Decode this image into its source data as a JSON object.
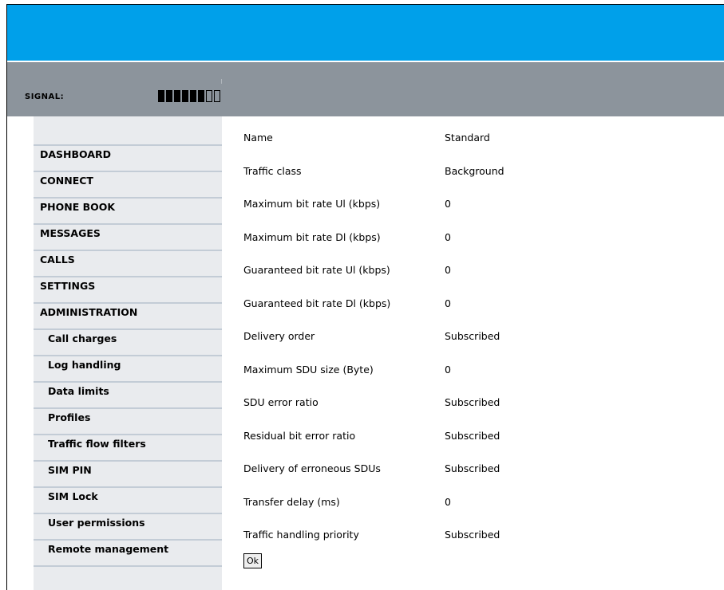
{
  "header": {
    "signal_label": "SIGNAL:",
    "signal_level": 6,
    "signal_max": 8,
    "brand_color": "#00a0ea",
    "status_bar_color": "#8c949c"
  },
  "sidebar": {
    "items": [
      {
        "label": "DASHBOARD"
      },
      {
        "label": "CONNECT"
      },
      {
        "label": "PHONE BOOK"
      },
      {
        "label": "MESSAGES"
      },
      {
        "label": "CALLS"
      },
      {
        "label": "SETTINGS"
      },
      {
        "label": "ADMINISTRATION"
      },
      {
        "label": "Call charges"
      },
      {
        "label": "Log handling"
      },
      {
        "label": "Data limits"
      },
      {
        "label": "Profiles"
      },
      {
        "label": "Traffic flow filters"
      },
      {
        "label": "SIM PIN"
      },
      {
        "label": "SIM Lock"
      },
      {
        "label": "User permissions"
      },
      {
        "label": "Remote management"
      }
    ]
  },
  "profile": {
    "rows": [
      {
        "label": "Name",
        "value": "Standard"
      },
      {
        "label": "Traffic class",
        "value": "Background"
      },
      {
        "label": "Maximum bit rate Ul (kbps)",
        "value": "0"
      },
      {
        "label": "Maximum bit rate Dl (kbps)",
        "value": "0"
      },
      {
        "label": "Guaranteed bit rate Ul (kbps)",
        "value": "0"
      },
      {
        "label": "Guaranteed bit rate Dl (kbps)",
        "value": "0"
      },
      {
        "label": "Delivery order",
        "value": "Subscribed"
      },
      {
        "label": "Maximum SDU size (Byte)",
        "value": "0"
      },
      {
        "label": "SDU error ratio",
        "value": "Subscribed"
      },
      {
        "label": "Residual bit error ratio",
        "value": "Subscribed"
      },
      {
        "label": "Delivery of erroneous SDUs",
        "value": "Subscribed"
      },
      {
        "label": "Transfer delay (ms)",
        "value": "0"
      },
      {
        "label": "Traffic handling priority",
        "value": "Subscribed"
      }
    ],
    "ok_label": "Ok"
  }
}
